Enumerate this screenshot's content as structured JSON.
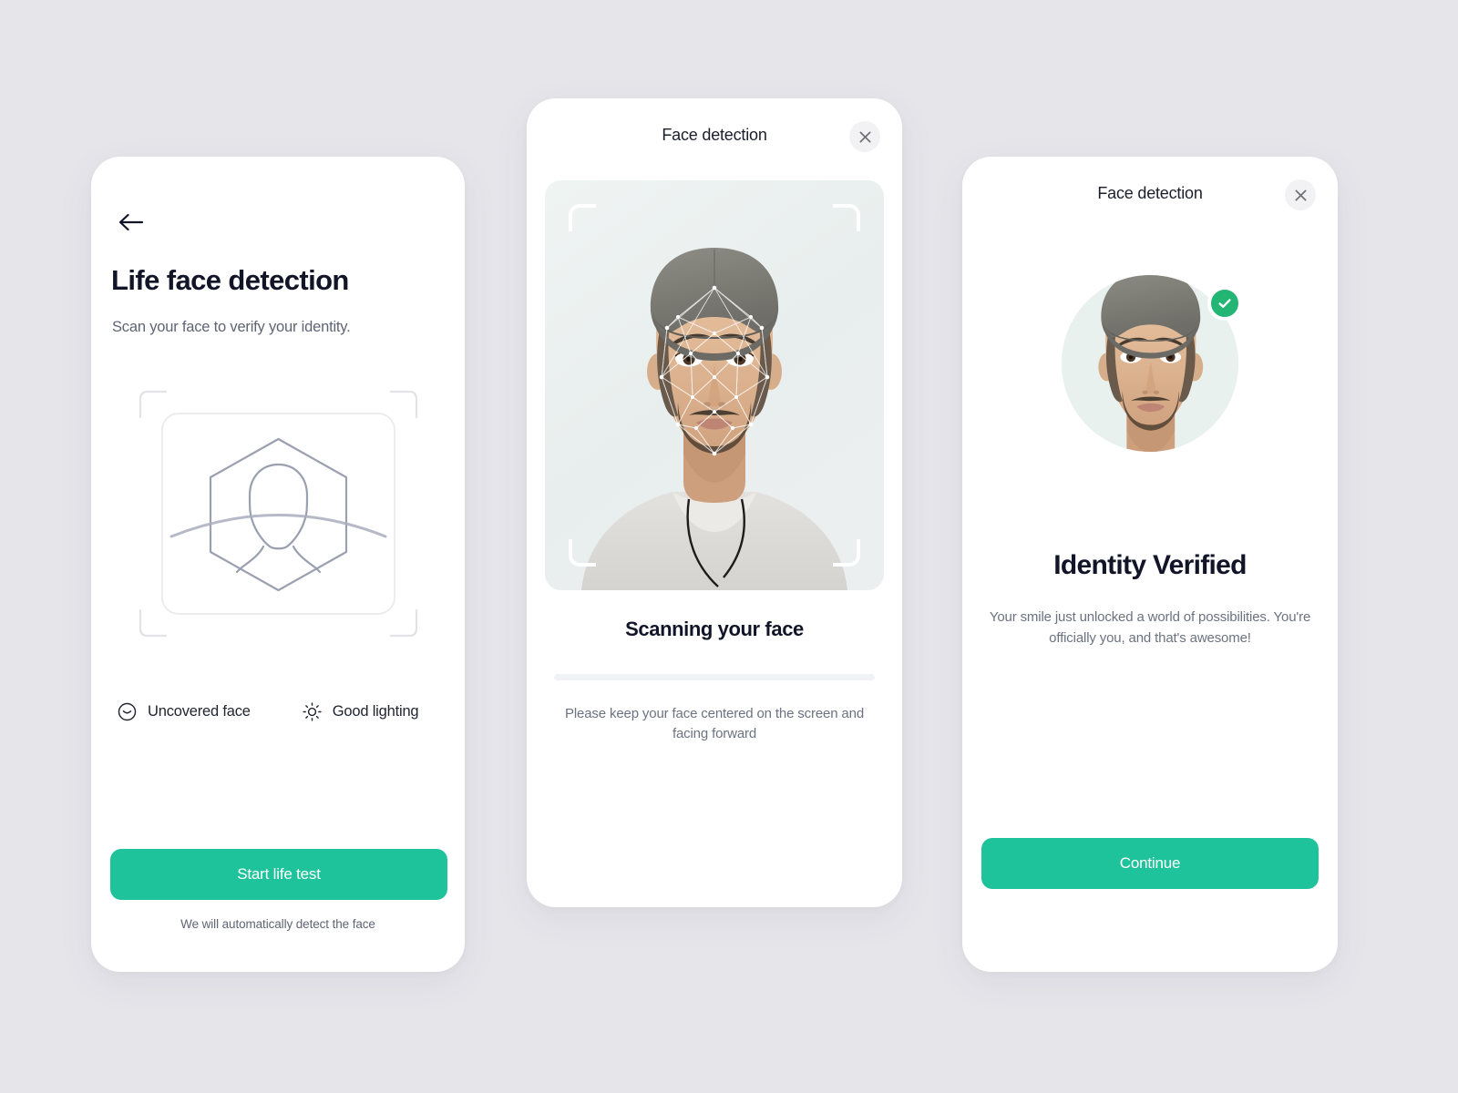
{
  "theme": {
    "page_background": "#e6e5ea",
    "card_background": "#ffffff",
    "accent_green": "#1fc39b",
    "badge_green": "#22b573",
    "heading_color": "#111527",
    "muted_text": "#6b7280"
  },
  "scan_card": {
    "back_icon": "arrow-left-icon",
    "title": "Life face detection",
    "subtitle": "Scan your face to verify your identity.",
    "illustration": "face-scan-hexagon-illustration",
    "features": [
      {
        "icon": "smiley-face-icon",
        "label": "Uncovered face"
      },
      {
        "icon": "sun-brightness-icon",
        "label": "Good lighting"
      }
    ],
    "primary_button": "Start life test",
    "footer_note": "We will automatically detect the face"
  },
  "detect_card": {
    "header_title": "Face detection",
    "close_icon": "close-icon",
    "camera": {
      "subject": "man-with-flat-cap-portrait",
      "overlay": "face-mesh-overlay",
      "corner_brackets": 4
    },
    "status": "Scanning your face",
    "progress_percent": 0,
    "hint": "Please keep your face centered on the screen and facing forward"
  },
  "verify_card": {
    "header_title": "Face detection",
    "close_icon": "close-icon",
    "avatar": "man-with-flat-cap-portrait",
    "badge_icon": "check-circle-icon",
    "title": "Identity Verified",
    "subtitle": "Your smile just unlocked a world of possibilities. You're officially you, and that's awesome!",
    "primary_button": "Continue"
  }
}
